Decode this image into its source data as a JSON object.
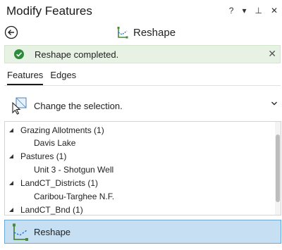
{
  "window": {
    "title": "Modify Features",
    "buttons": [
      "?",
      "▾",
      "⊥",
      "✕"
    ]
  },
  "tool": {
    "name": "Reshape",
    "icon": "reshape-icon"
  },
  "message": {
    "text": "Reshape completed.",
    "status_color": "#2e8b3d",
    "background": "#e7f1e4"
  },
  "tabs": [
    {
      "label": "Features",
      "active": true
    },
    {
      "label": "Edges",
      "active": false
    }
  ],
  "selection": {
    "label": "Change the selection."
  },
  "tree": [
    {
      "group": "Grazing Allotments (1)",
      "items": [
        "Davis Lake"
      ]
    },
    {
      "group": "Pastures (1)",
      "items": [
        "Unit 3 - Shotgun Well"
      ]
    },
    {
      "group": "LandCT_Districts (1)",
      "items": [
        "Caribou-Targhee N.F."
      ]
    },
    {
      "group": "LandCT_Bnd (1)",
      "items": []
    }
  ],
  "active_tool": {
    "label": "Reshape",
    "highlight": "#c6dff3"
  }
}
